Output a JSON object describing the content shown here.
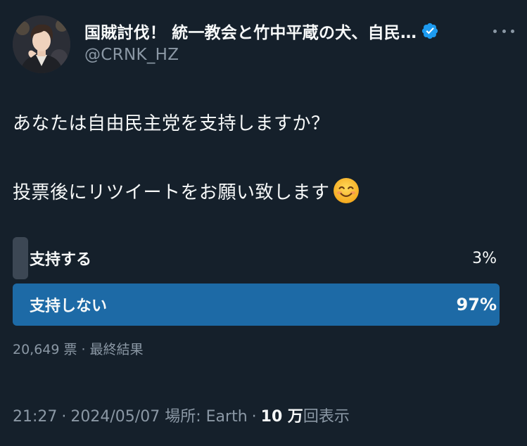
{
  "author": {
    "display_name": "国賊討伐！ 統一教会と竹中平蔵の犬、自民…",
    "handle": "@CRNK_HZ"
  },
  "tweet": {
    "line1": "あなたは自由民主党を支持しますか？",
    "line2": "投票後にリツイートをお願い致します"
  },
  "poll": {
    "options": [
      {
        "label": "支持する",
        "percent_text": "3%",
        "percent": 3
      },
      {
        "label": "支持しない",
        "percent_text": "97%",
        "percent": 97
      }
    ],
    "votes": "20,649 票",
    "status": "最終結果"
  },
  "meta": {
    "time": "21:27",
    "date": "2024/05/07",
    "location_label": "場所:",
    "location": "Earth",
    "views_num": "10 万",
    "views_label": "回表示"
  },
  "colors": {
    "background": "#15202b",
    "text": "#f7f9f9",
    "muted": "#8b98a5",
    "winner_bar": "#1d6aa6",
    "loser_bar": "#3c4754",
    "verified": "#1d9bf0"
  },
  "icons": {
    "verified": "verified-badge-icon",
    "more": "more-options-icon",
    "emoji": "smiling-face-emoji"
  }
}
